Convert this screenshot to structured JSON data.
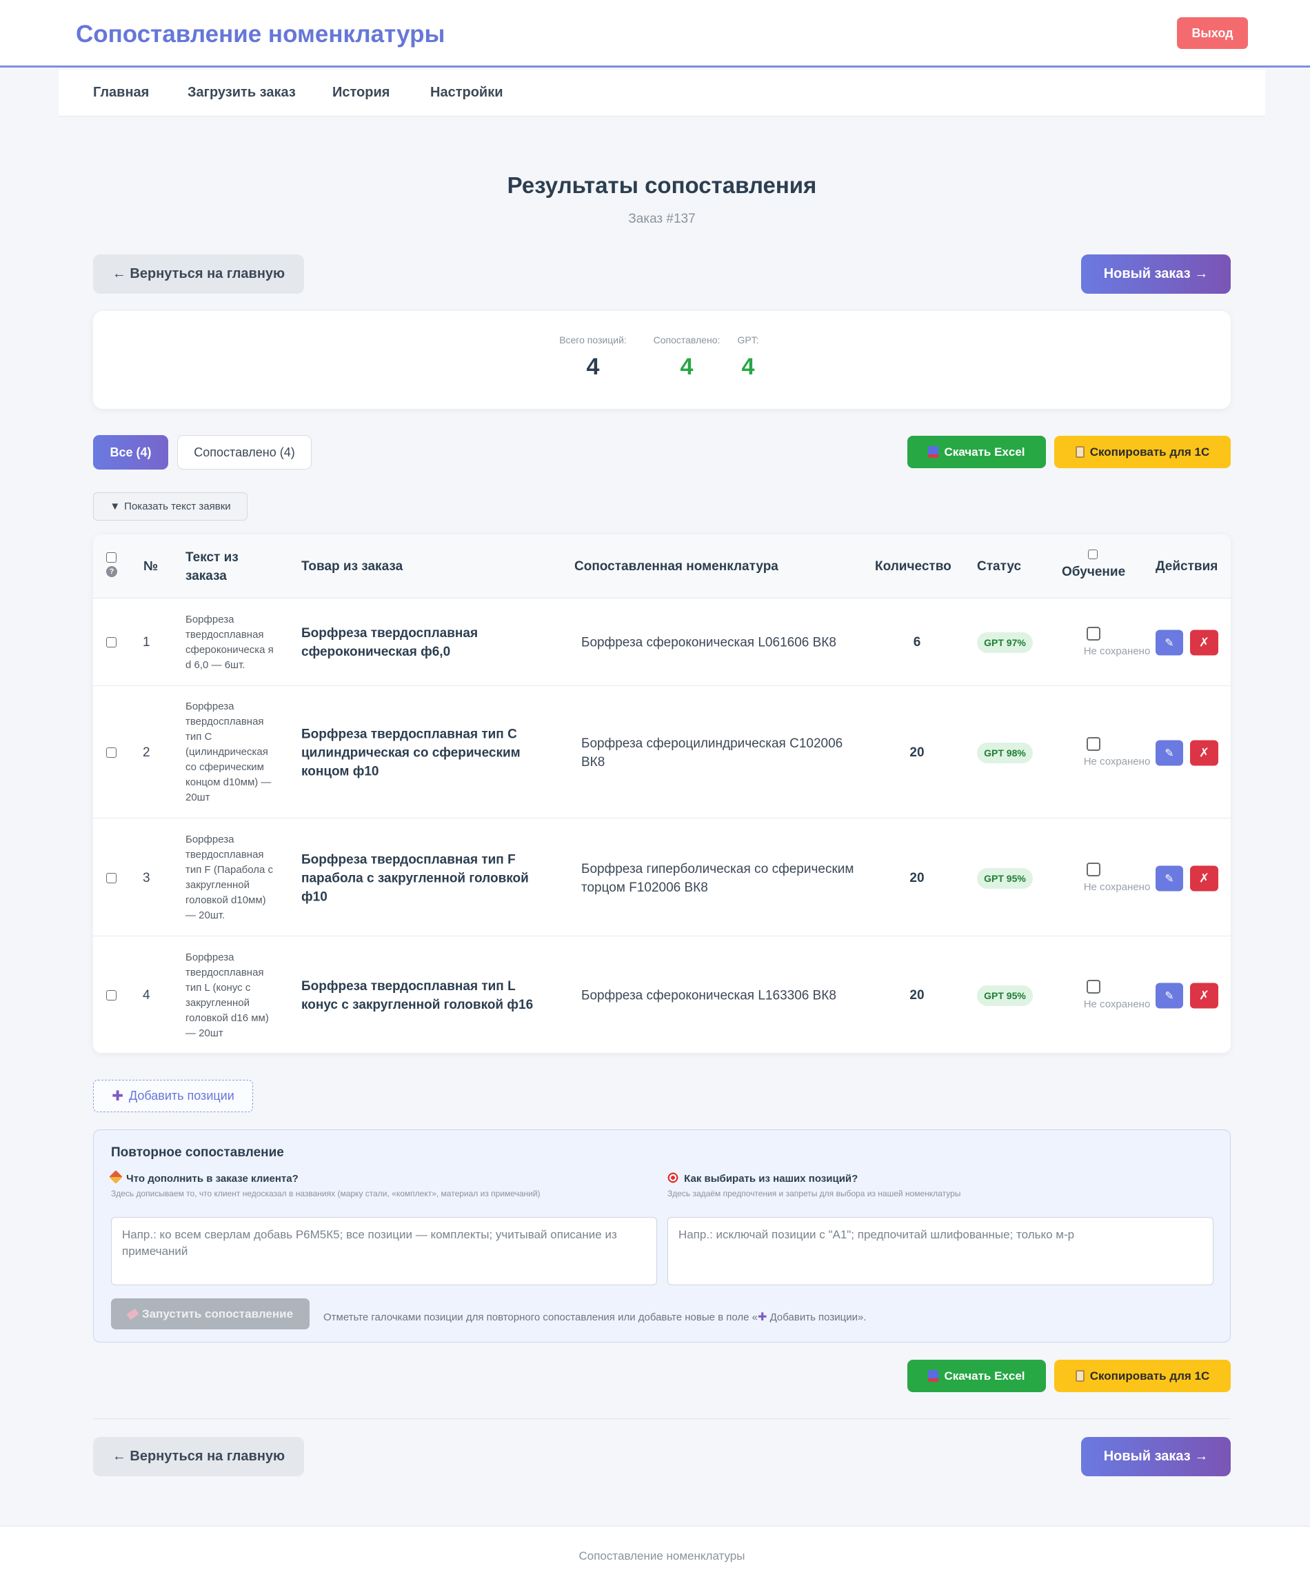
{
  "app": {
    "title": "Сопоставление номенклатуры",
    "logout_label": "Выход"
  },
  "nav": {
    "items": [
      "Главная",
      "Загрузить заказ",
      "История",
      "Настройки"
    ]
  },
  "page": {
    "title": "Результаты сопоставления",
    "subtitle": "Заказ #137"
  },
  "buttons": {
    "back_label": "← Вернуться на главную",
    "new_order_label": "Новый заказ →",
    "excel_label": "Скачать Excel",
    "copy_1c_label": "Скопировать для 1С",
    "toggle_text_label": "Показать текст заявки",
    "add_positions_label": "Добавить позиции",
    "edit_icon": "✎",
    "delete_icon": "✗"
  },
  "stats": {
    "total_label": "Всего позиций:",
    "total_value": "4",
    "matched_label": "Сопоставлено:",
    "matched_value": "4",
    "gpt_label": "GPT:",
    "gpt_value": "4",
    "colors": {
      "total": "#2c3e50",
      "matched": "#28a745",
      "gpt": "#28a745"
    }
  },
  "filters": {
    "all_label": "Все (4)",
    "matched_label": "Сопоставлено (4)"
  },
  "table": {
    "headers": {
      "help": "?",
      "num": "№",
      "source_text": "Текст из заказа",
      "order_item": "Товар из заказа",
      "matched": "Сопоставленная номенклатура",
      "qty": "Количество",
      "status": "Статус",
      "training": "Обучение",
      "actions": "Действия"
    },
    "rows": [
      {
        "num": "1",
        "source": "Борфреза твердосплавная сфероконическа я d 6,0 — 6шт.",
        "item": "Борфреза твердосплавная сфероконическая ф6,0",
        "match": "Борфреза сфероконическая L061606 ВК8",
        "qty": "6",
        "status": "GPT 97%",
        "training_note": "Не сохранено"
      },
      {
        "num": "2",
        "source": "Борфреза твердосплавная тип С (цилиндрическая со сферическим концом d10мм) — 20шт",
        "item": "Борфреза твердосплавная тип С цилиндрическая со сферическим концом ф10",
        "match": "Борфреза сфероцилиндрическая С102006 ВК8",
        "qty": "20",
        "status": "GPT 98%",
        "training_note": "Не сохранено"
      },
      {
        "num": "3",
        "source": "Борфреза твердосплавная тип F (Парабола с закругленной головкой d10мм) — 20шт.",
        "item": "Борфреза твердосплавная тип F парабола с закругленной головкой ф10",
        "match": "Борфреза гиперболическая со сферическим торцом F102006 ВК8",
        "qty": "20",
        "status": "GPT 95%",
        "training_note": "Не сохранено"
      },
      {
        "num": "4",
        "source": "Борфреза твердосплавная тип L (конус с закругленной головкой d16 мм) — 20шт",
        "item": "Борфреза твердосплавная тип L конус с закругленной головкой ф16",
        "match": "Борфреза сфероконическая L163306 ВК8",
        "qty": "20",
        "status": "GPT 95%",
        "training_note": "Не сохранено"
      }
    ]
  },
  "rematch": {
    "title": "Повторное сопоставление",
    "left_label": "Что дополнить в заказе клиента?",
    "left_hint": "Здесь дописываем то, что клиент недосказал в названиях (марку стали, «комплект», материал из примечаний)",
    "left_placeholder": "Напр.: ко всем сверлам добавь Р6М5К5; все позиции — комплекты; учитывай описание из примечаний",
    "right_label": "Как выбирать из наших позиций?",
    "right_hint": "Здесь задаём предпочтения и запреты для выбора из нашей номенклатуры",
    "right_placeholder": "Напр.: исключай позиции с \"А1\"; предпочитай шлифованные; только м-р",
    "run_label": "Запустить сопоставление",
    "note_prefix": "Отметьте галочками позиции для повторного сопоставления или добавьте новые в поле «",
    "note_plus": "✚",
    "note_suffix": " Добавить позиции»."
  },
  "footer": {
    "text": "Сопоставление номенклатуры"
  },
  "icons": {
    "add": "plus-icon",
    "excel": "excel-icon",
    "copy": "clipboard-icon",
    "pencil": "pencil-icon",
    "target": "target-icon",
    "eraser": "eraser-icon",
    "toggle": "triangle-down-icon"
  }
}
